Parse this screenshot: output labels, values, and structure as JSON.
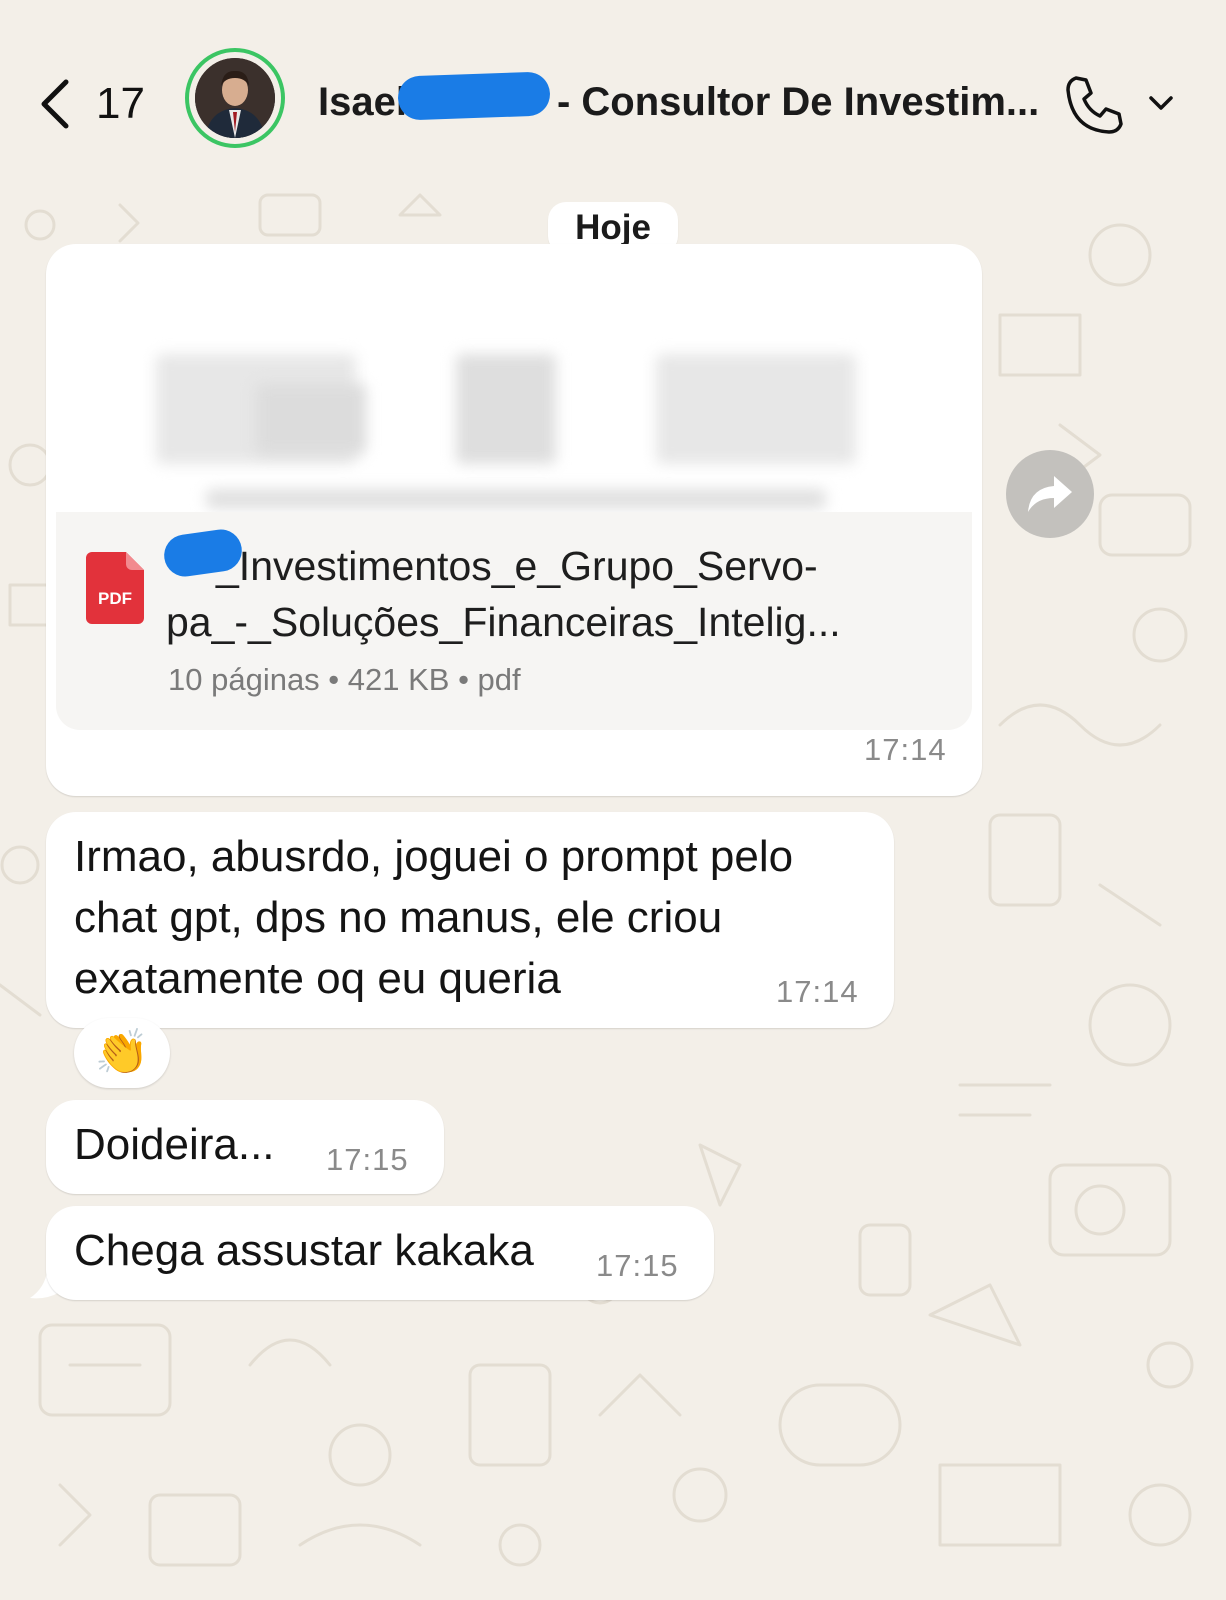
{
  "header": {
    "back_count": "17",
    "contact_name_prefix": "Isael",
    "contact_name_suffix": "- Consultor De Investim..."
  },
  "day_label": "Hoje",
  "messages": [
    {
      "type": "document",
      "file_name_line1": "_Investimentos_e_Grupo_Servo-",
      "file_name_line2": "pa_-_Soluções_Financeiras_Intelig...",
      "file_icon_label": "PDF",
      "meta": "10 páginas • 421 KB • pdf",
      "time": "17:14"
    },
    {
      "type": "text",
      "line1": "Irmao, abusrdo, joguei o prompt pelo",
      "line2": "chat gpt, dps no manus, ele criou",
      "line3": "exatamente oq eu queria",
      "time": "17:14",
      "reaction": "👏"
    },
    {
      "type": "text",
      "text": "Doideira...",
      "time": "17:15"
    },
    {
      "type": "text",
      "text": "Chega assustar kakaka",
      "time": "17:15"
    }
  ],
  "icons": {
    "back": "chevron-left-icon",
    "call": "phone-icon",
    "call_menu": "chevron-down-icon",
    "forward": "forward-arrow-icon",
    "file": "pdf-file-icon"
  },
  "colors": {
    "background": "#f3efe8",
    "bubble": "#ffffff",
    "status_ring": "#3bc563",
    "redaction": "#1a7ce6",
    "pdf_red": "#e2323b"
  }
}
